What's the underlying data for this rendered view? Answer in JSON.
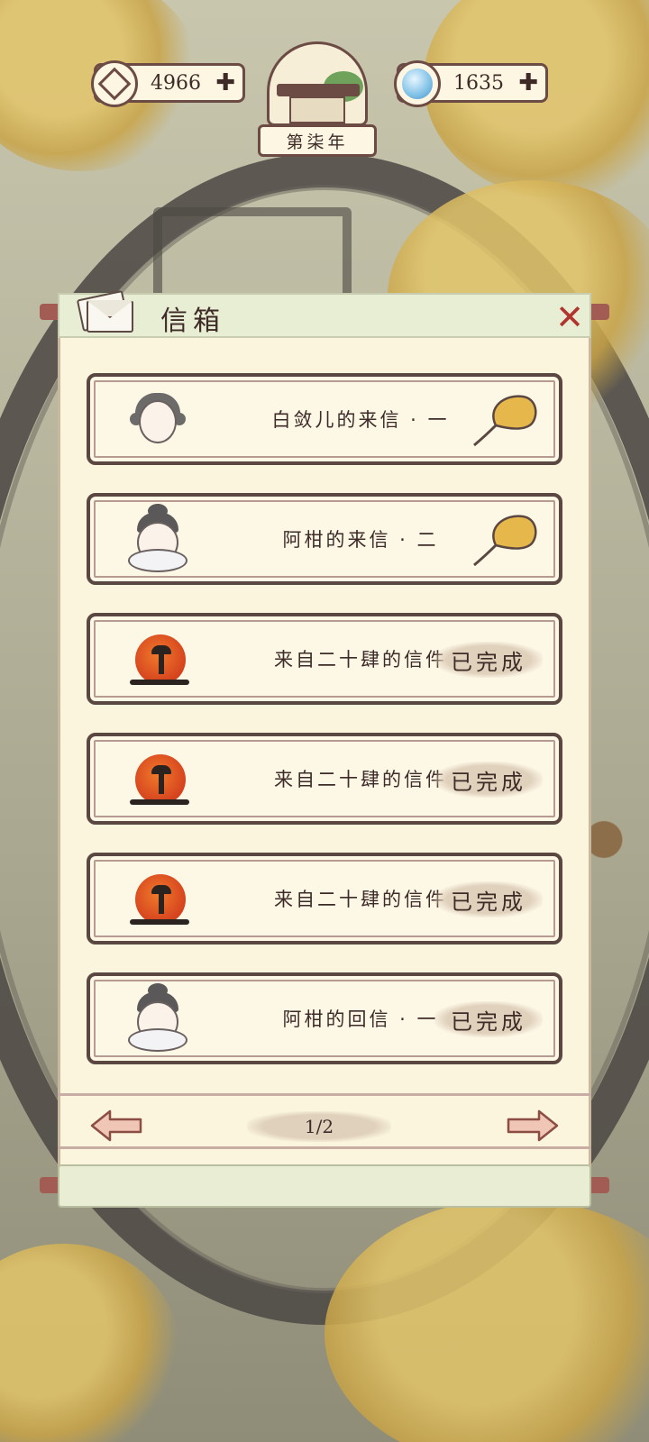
{
  "topbar": {
    "coins": {
      "value": "4966",
      "icon": "coin-icon"
    },
    "water": {
      "value": "1635",
      "icon": "water-drop-icon"
    },
    "year_label": "第柒年"
  },
  "mailbox": {
    "title": "信箱",
    "close_icon": "close-icon",
    "letters": [
      {
        "name": "白敛儿的来信 · 一",
        "avatar": "lady-avatar",
        "right": {
          "type": "reward",
          "icon": "ginkgo-leaf-icon"
        }
      },
      {
        "name": "阿柑的来信 · 二",
        "avatar": "girl-avatar",
        "right": {
          "type": "reward",
          "icon": "ginkgo-leaf-icon"
        }
      },
      {
        "name": "来自二十肆的信件",
        "avatar": "sun-mushroom-avatar",
        "right": {
          "type": "status",
          "text": "已完成"
        }
      },
      {
        "name": "来自二十肆的信件",
        "avatar": "sun-mushroom-avatar",
        "right": {
          "type": "status",
          "text": "已完成"
        }
      },
      {
        "name": "来自二十肆的信件",
        "avatar": "sun-mushroom-avatar",
        "right": {
          "type": "status",
          "text": "已完成"
        }
      },
      {
        "name": "阿柑的回信 · 一",
        "avatar": "girl-avatar",
        "right": {
          "type": "status",
          "text": "已完成"
        }
      }
    ],
    "pagination": {
      "page": "1/2"
    }
  }
}
